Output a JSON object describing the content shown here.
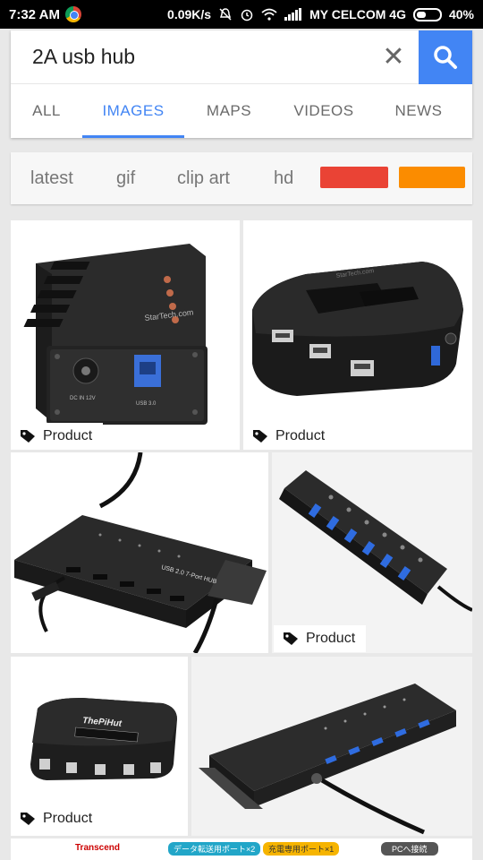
{
  "status_bar": {
    "time": "7:32 AM",
    "network_speed": "0.09K/s",
    "carrier": "MY CELCOM 4G",
    "battery": "40%",
    "battery_level": 0.4,
    "icons": [
      "chrome-icon",
      "mute-icon",
      "alarm-icon",
      "wifi-icon",
      "signal-icon",
      "battery-icon"
    ]
  },
  "search": {
    "query": "2A usb hub",
    "clear_icon": "close-icon",
    "search_icon": "search-icon",
    "accent": "#4285f4"
  },
  "tabs": [
    {
      "label": "ALL",
      "active": false
    },
    {
      "label": "IMAGES",
      "active": true
    },
    {
      "label": "MAPS",
      "active": false
    },
    {
      "label": "VIDEOS",
      "active": false
    },
    {
      "label": "NEWS",
      "active": false
    }
  ],
  "chips": {
    "items": [
      "latest",
      "gif",
      "clip art",
      "hd"
    ],
    "color_swatches": [
      "#ea4335",
      "#fb8c00"
    ]
  },
  "results": [
    {
      "badge": "Product"
    },
    {
      "badge": "Product"
    },
    {
      "badge": ""
    },
    {
      "badge": "Product"
    },
    {
      "badge": "Product"
    },
    {
      "badge": ""
    }
  ],
  "image_texts": {
    "startech_label": "StarTech.com",
    "dc_label": "DC IN 12V",
    "usb_label": "USB 3.0",
    "hub2_label": "USB 2.0 7-Port HUB",
    "thepihut_label": "ThePiHut",
    "transcend": "Transcend",
    "strip_label_1": "データ転送用ポート×2",
    "strip_label_2": "充電専用ポート×1",
    "strip_label_3": "PCへ接続"
  }
}
